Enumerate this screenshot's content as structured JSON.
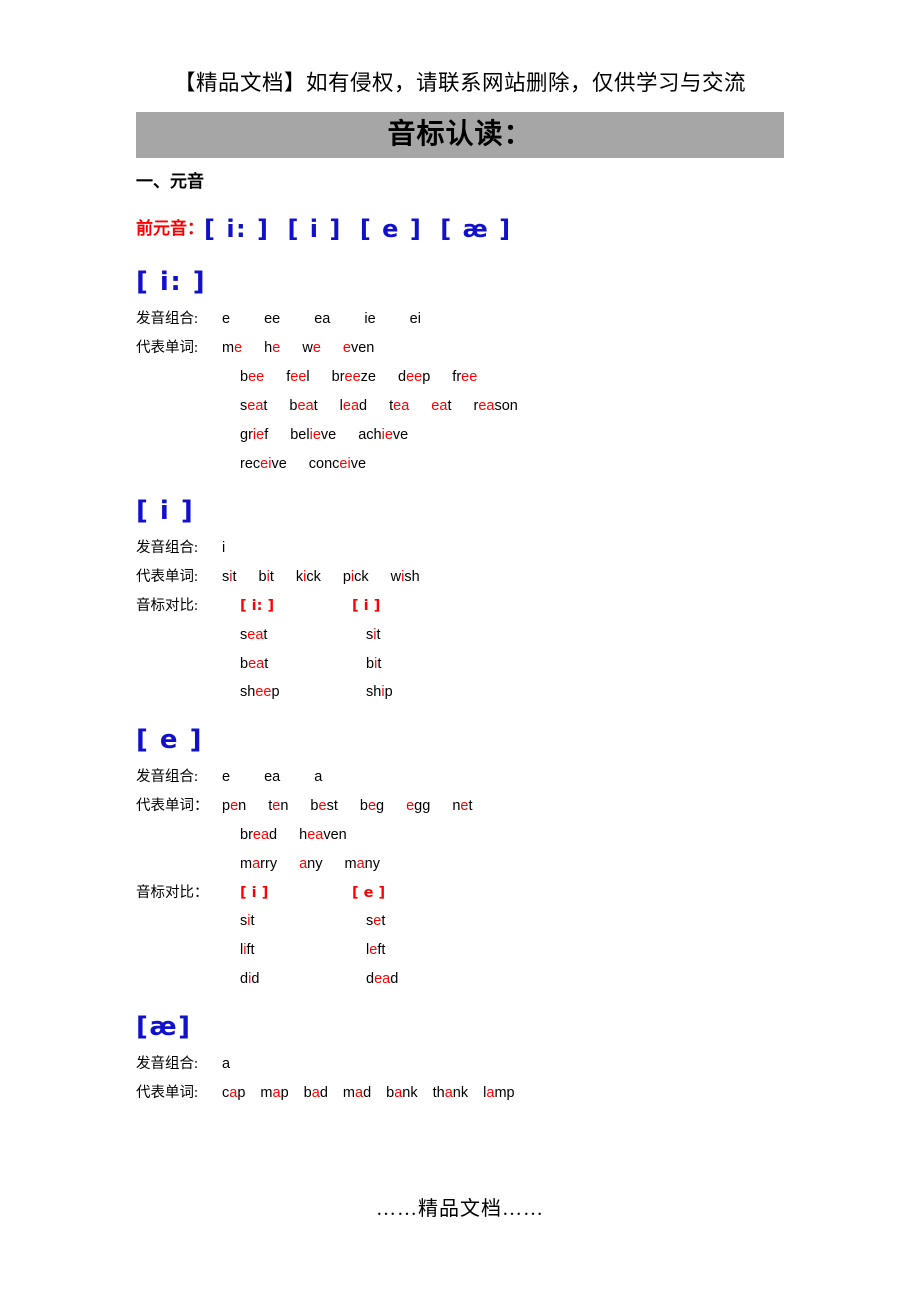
{
  "document": {
    "disclaimer": "【精品文档】如有侵权，请联系网站删除，仅供学习与交流",
    "title": "音标认读：",
    "title_bar_color": "#a6a6a6",
    "footer": "……精品文档……",
    "section_heading": "一、元音"
  },
  "colors": {
    "phoneme_blue": "#1111cc",
    "highlight_red": "#ff0000",
    "text_black": "#000000",
    "bar_gray": "#a6a6a6"
  },
  "front_vowels": {
    "label": "前元音：",
    "symbols": [
      "[ i: ]",
      "[ i ]",
      "[ e ]",
      "[ æ ]"
    ]
  },
  "labels": {
    "combination": "发音组合:",
    "combination_alt": "发音组合：",
    "words": "代表单词:",
    "words_alt": "代表单词：",
    "compare": "音标对比:",
    "compare_alt": "音标对比："
  },
  "sections": [
    {
      "phoneme": "[ i: ]",
      "combination_label": "发音组合:",
      "combinations": [
        "e",
        "ee",
        "ea",
        "ie",
        "ei"
      ],
      "words_label": "代表单词:",
      "word_rows": [
        [
          {
            "pre": "m",
            "hl": "e",
            "post": ""
          },
          {
            "pre": "h",
            "hl": "e",
            "post": ""
          },
          {
            "pre": "w",
            "hl": "e",
            "post": ""
          },
          {
            "pre": "",
            "hl": "e",
            "post": "ven"
          }
        ],
        [
          {
            "pre": "b",
            "hl": "ee",
            "post": ""
          },
          {
            "pre": "f",
            "hl": "ee",
            "post": "l"
          },
          {
            "pre": "br",
            "hl": "ee",
            "post": "ze"
          },
          {
            "pre": "d",
            "hl": "ee",
            "post": "p"
          },
          {
            "pre": "fr",
            "hl": "ee",
            "post": ""
          }
        ],
        [
          {
            "pre": "s",
            "hl": "ea",
            "post": "t"
          },
          {
            "pre": "b",
            "hl": "ea",
            "post": "t"
          },
          {
            "pre": "l",
            "hl": "ea",
            "post": "d"
          },
          {
            "pre": "t",
            "hl": "ea",
            "post": ""
          },
          {
            "pre": "",
            "hl": "ea",
            "post": "t"
          },
          {
            "pre": "r",
            "hl": "ea",
            "post": "son"
          }
        ],
        [
          {
            "pre": "gr",
            "hl": "ie",
            "post": "f"
          },
          {
            "pre": "bel",
            "hl": "ie",
            "post": "ve"
          },
          {
            "pre": "ach",
            "hl": "ie",
            "post": "ve"
          }
        ],
        [
          {
            "pre": "rec",
            "hl": "ei",
            "post": "ve"
          },
          {
            "pre": "conc",
            "hl": "ei",
            "post": "ve"
          }
        ]
      ],
      "comparison": null
    },
    {
      "phoneme": "[ i ]",
      "combination_label": "发音组合:",
      "combinations": [
        "i"
      ],
      "words_label": "代表单词:",
      "word_rows": [
        [
          {
            "pre": "s",
            "hl": "i",
            "post": "t"
          },
          {
            "pre": "b",
            "hl": "i",
            "post": "t"
          },
          {
            "pre": "k",
            "hl": "i",
            "post": "ck"
          },
          {
            "pre": "p",
            "hl": "i",
            "post": "ck"
          },
          {
            "pre": "w",
            "hl": "i",
            "post": "sh"
          }
        ]
      ],
      "comparison": {
        "label": "音标对比:",
        "headers": [
          "[ i: ]",
          "[ i ]"
        ],
        "rows": [
          [
            {
              "pre": "s",
              "hl": "ea",
              "post": "t"
            },
            {
              "pre": "s",
              "hl": "i",
              "post": "t"
            }
          ],
          [
            {
              "pre": "b",
              "hl": "ea",
              "post": "t"
            },
            {
              "pre": "b",
              "hl": "i",
              "post": "t"
            }
          ],
          [
            {
              "pre": "sh",
              "hl": "ee",
              "post": "p"
            },
            {
              "pre": "sh",
              "hl": "i",
              "post": "p"
            }
          ]
        ]
      }
    },
    {
      "phoneme": "[ e ]",
      "combination_label": "发音组合:",
      "combinations": [
        "e",
        "ea",
        "a"
      ],
      "words_label": "代表单词：",
      "word_rows": [
        [
          {
            "pre": "p",
            "hl": "e",
            "post": "n"
          },
          {
            "pre": "t",
            "hl": "e",
            "post": "n"
          },
          {
            "pre": "b",
            "hl": "e",
            "post": "st"
          },
          {
            "pre": "b",
            "hl": "e",
            "post": "g"
          },
          {
            "pre": "",
            "hl": "e",
            "post": "gg"
          },
          {
            "pre": "n",
            "hl": "e",
            "post": "t"
          }
        ],
        [
          {
            "pre": "br",
            "hl": "ea",
            "post": "d"
          },
          {
            "pre": "h",
            "hl": "ea",
            "post": "ven"
          }
        ],
        [
          {
            "pre": "m",
            "hl": "a",
            "post": "rry"
          },
          {
            "pre": "",
            "hl": "a",
            "post": "ny"
          },
          {
            "pre": "m",
            "hl": "a",
            "post": "ny"
          }
        ]
      ],
      "comparison": {
        "label": "音标对比：",
        "headers": [
          "[ i ]",
          "[ e ]"
        ],
        "rows": [
          [
            {
              "pre": "s",
              "hl": "i",
              "post": "t"
            },
            {
              "pre": "s",
              "hl": "e",
              "post": "t"
            }
          ],
          [
            {
              "pre": "l",
              "hl": "i",
              "post": "ft"
            },
            {
              "pre": "l",
              "hl": "e",
              "post": "ft"
            }
          ],
          [
            {
              "pre": "d",
              "hl": "i",
              "post": "d"
            },
            {
              "pre": "d",
              "hl": "ea",
              "post": "d"
            }
          ]
        ]
      }
    },
    {
      "phoneme": "[æ]",
      "combination_label": "发音组合:",
      "combinations": [
        "a"
      ],
      "words_label": "代表单词:",
      "word_rows": [
        [
          {
            "pre": "c",
            "hl": "a",
            "post": "p"
          },
          {
            "pre": "m",
            "hl": "a",
            "post": "p"
          },
          {
            "pre": "b",
            "hl": "a",
            "post": "d"
          },
          {
            "pre": "m",
            "hl": "a",
            "post": "d"
          },
          {
            "pre": "b",
            "hl": "a",
            "post": "nk"
          },
          {
            "pre": "th",
            "hl": "a",
            "post": "nk"
          },
          {
            "pre": "l",
            "hl": "a",
            "post": "mp"
          }
        ]
      ],
      "comparison": null
    }
  ]
}
